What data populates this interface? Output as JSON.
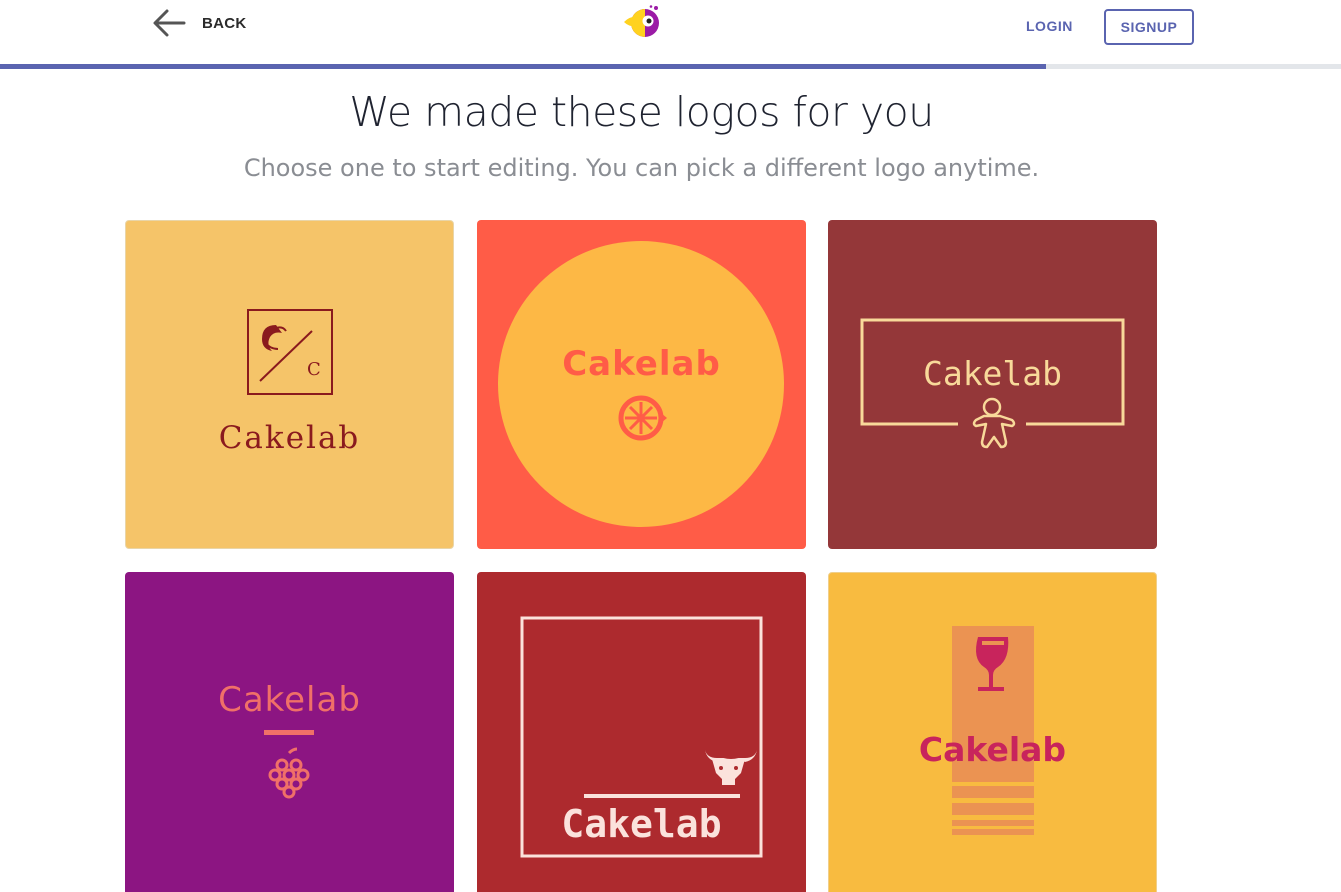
{
  "header": {
    "back_label": "BACK",
    "login_label": "LOGIN",
    "signup_label": "SIGNUP",
    "brand_icon": "toucan-logo-icon",
    "back_icon": "arrow-left-icon"
  },
  "progress": {
    "fraction": 0.78
  },
  "main": {
    "title": "We made these logos for you",
    "subtitle": "Choose one to start editing. You can pick a different logo anytime."
  },
  "logos": [
    {
      "text": "Cakelab",
      "monogram": "C",
      "icon": "shrimp-icon",
      "background": "#f5c469",
      "text_color": "#8a1a1e"
    },
    {
      "text": "Cakelab",
      "icon": "lemon-slice-icon",
      "background": "#ff5c47",
      "text_color": "#ff5c47"
    },
    {
      "text": "Cakelab",
      "icon": "gingerbread-man-icon",
      "background": "#943739",
      "text_color": "#f8d99a"
    },
    {
      "text": "Cakelab",
      "icon": "grapes-icon",
      "background": "#8c1582",
      "text_color": "#f07068"
    },
    {
      "text": "Cakelab",
      "icon": "bull-head-icon",
      "background": "#ad2a2e",
      "text_color": "#fbe2dc"
    },
    {
      "text": "Cakelab",
      "icon": "wine-glass-icon",
      "background": "#f8bb40",
      "text_color": "#c8245c"
    }
  ],
  "colors": {
    "accent": "#5a64b0"
  }
}
